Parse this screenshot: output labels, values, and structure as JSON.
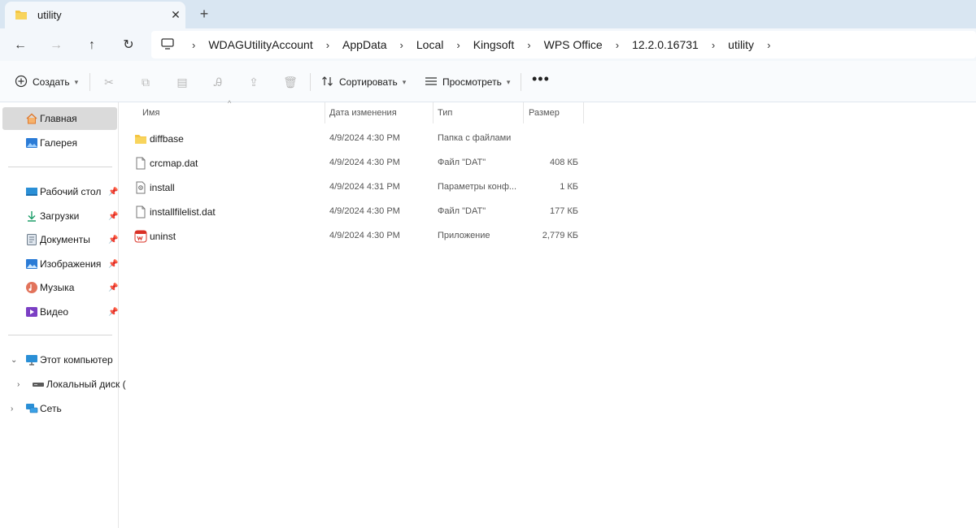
{
  "tab": {
    "title": "utility",
    "close": "✕",
    "new": "+"
  },
  "nav": {
    "back": "←",
    "forward": "→",
    "up": "↑",
    "refresh": "↻",
    "crumbs": [
      "WDAGUtilityAccount",
      "AppData",
      "Local",
      "Kingsoft",
      "WPS Office",
      "12.2.0.16731",
      "utility"
    ],
    "separator": "›"
  },
  "commands": {
    "new": "Создать",
    "sort": "Сортировать",
    "view": "Просмотреть",
    "more": "•••"
  },
  "columns": {
    "name": "Имя",
    "date": "Дата изменения",
    "type": "Тип",
    "size": "Размер"
  },
  "sidebar": {
    "home": "Главная",
    "gallery": "Галерея",
    "pinned": [
      {
        "label": "Рабочий стол",
        "icon": "desktop-icon"
      },
      {
        "label": "Загрузки",
        "icon": "download-icon"
      },
      {
        "label": "Документы",
        "icon": "documents-icon"
      },
      {
        "label": "Изображения",
        "icon": "pictures-icon"
      },
      {
        "label": "Музыка",
        "icon": "music-icon"
      },
      {
        "label": "Видео",
        "icon": "video-icon"
      }
    ],
    "this_pc": "Этот компьютер",
    "local_disk": "Локальный диск (",
    "network": "Сеть"
  },
  "files": [
    {
      "name": "diffbase",
      "date": "4/9/2024 4:30 PM",
      "type": "Папка с файлами",
      "size": "",
      "icon": "folder-icon"
    },
    {
      "name": "crcmap.dat",
      "date": "4/9/2024 4:30 PM",
      "type": "Файл \"DAT\"",
      "size": "408 КБ",
      "icon": "file-icon"
    },
    {
      "name": "install",
      "date": "4/9/2024 4:31 PM",
      "type": "Параметры конф...",
      "size": "1 КБ",
      "icon": "config-file-icon"
    },
    {
      "name": "installfilelist.dat",
      "date": "4/9/2024 4:30 PM",
      "type": "Файл \"DAT\"",
      "size": "177 КБ",
      "icon": "file-icon"
    },
    {
      "name": "uninst",
      "date": "4/9/2024 4:30 PM",
      "type": "Приложение",
      "size": "2,779 КБ",
      "icon": "wps-app-icon"
    }
  ],
  "colors": {
    "tabbar": "#d9e6f2",
    "navbar": "#f3f7fb",
    "active": "#dadada",
    "folder": "#f4c542"
  }
}
